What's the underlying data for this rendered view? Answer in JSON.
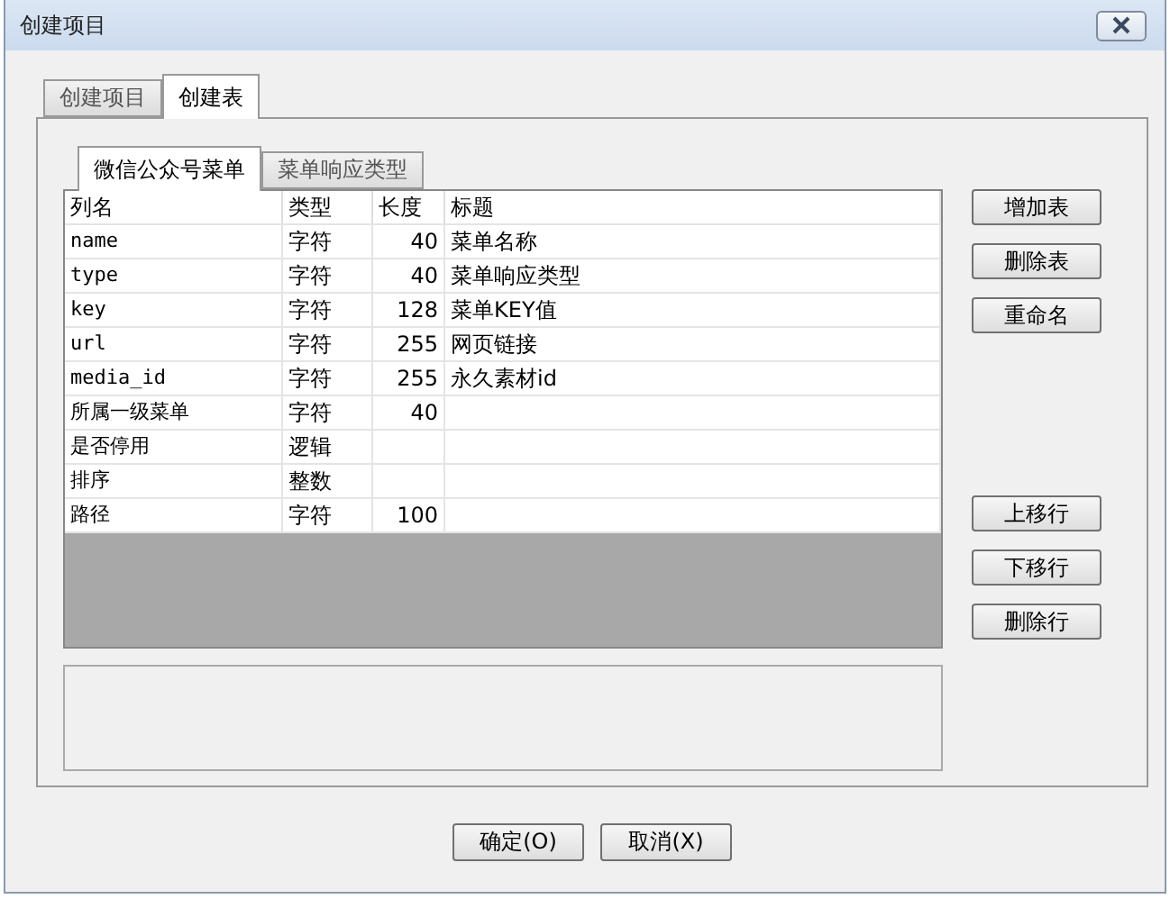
{
  "window": {
    "title": "创建项目"
  },
  "tabs": [
    {
      "label": "创建项目",
      "selected": false
    },
    {
      "label": "创建表",
      "selected": true
    }
  ],
  "inner_tabs": [
    {
      "label": "微信公众号菜单",
      "selected": true
    },
    {
      "label": "菜单响应类型",
      "selected": false
    }
  ],
  "table": {
    "columns": [
      "列名",
      "类型",
      "长度",
      "标题"
    ],
    "rows": [
      {
        "name": "name",
        "type": "字符",
        "length": "40",
        "title": "菜单名称"
      },
      {
        "name": "type",
        "type": "字符",
        "length": "40",
        "title": "菜单响应类型"
      },
      {
        "name": "key",
        "type": "字符",
        "length": "128",
        "title": "菜单KEY值"
      },
      {
        "name": "url",
        "type": "字符",
        "length": "255",
        "title": "网页链接"
      },
      {
        "name": "media_id",
        "type": "字符",
        "length": "255",
        "title": "永久素材id"
      },
      {
        "name": "所属一级菜单",
        "type": "字符",
        "length": "40"
      },
      {
        "name": "是否停用",
        "type": "逻辑"
      },
      {
        "name": "排序",
        "type": "整数"
      },
      {
        "name": "路径",
        "type": "字符",
        "length": "100"
      }
    ]
  },
  "table_buttons": [
    "增加表",
    "删除表",
    "重命名"
  ],
  "row_buttons": [
    "上移行",
    "下移行",
    "删除行"
  ],
  "footer_buttons": [
    "确定(O)",
    "取消(X)"
  ]
}
